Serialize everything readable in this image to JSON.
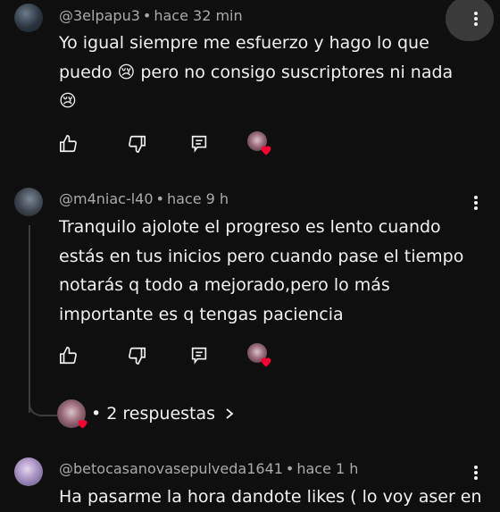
{
  "comments": [
    {
      "author": "@3elpapu3",
      "time": "hace 32 min",
      "lines": [
        "Yo igual siempre me esfuerzo y hago lo que",
        "puedo 😢 pero no consigo suscriptores ni nada",
        "😢"
      ]
    },
    {
      "author": "@m4niac-l40",
      "time": "hace 9 h",
      "lines": [
        "Tranquilo ajolote el progreso es lento cuando",
        "estás en tus inicios pero cuando pase el tiempo",
        "notarás q todo a mejorado,pero lo más",
        "importante es q tengas paciencia"
      ],
      "replies_label": "• 2 respuestas"
    },
    {
      "author": "@betocasanovasepulveda1641",
      "time": "hace 1 h",
      "lines": [
        "Ha pasarme la hora dandote likes ( lo voy aser en"
      ]
    }
  ],
  "separator": "•",
  "icons": {
    "like": "thumb-up-icon",
    "dislike": "thumb-down-icon",
    "reply": "reply-comment-icon",
    "menu": "more-vert-icon",
    "chevron": "chevron-right-icon",
    "heart": "creator-heart-icon"
  },
  "colors": {
    "background": "#0f0f0f",
    "text": "#f1f1f1",
    "meta": "#aaaaaa",
    "heart": "#ff0033"
  }
}
